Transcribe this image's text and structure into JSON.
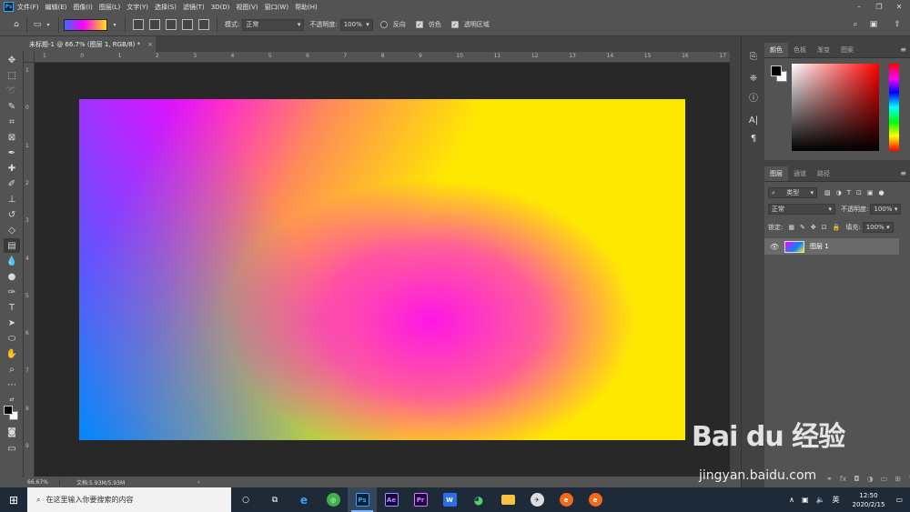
{
  "menu": {
    "logo": "Ps",
    "items": [
      "文件(F)",
      "编辑(E)",
      "图像(I)",
      "图层(L)",
      "文字(Y)",
      "选择(S)",
      "滤镜(T)",
      "3D(D)",
      "视图(V)",
      "窗口(W)",
      "帮助(H)"
    ]
  },
  "options": {
    "mode_label": "模式:",
    "mode_value": "正常",
    "opacity_label": "不透明度:",
    "opacity_value": "100%",
    "reverse_label": "反向",
    "dither_label": "仿色",
    "transparency_label": "透明区域"
  },
  "document": {
    "tab_title": "未标题-1 @ 66.7% (图层 1, RGB/8) *",
    "close": "×"
  },
  "ruler": {
    "top_ticks": [
      "1",
      "0",
      "1",
      "2",
      "3",
      "4",
      "5",
      "6",
      "7",
      "8",
      "9",
      "10",
      "11",
      "12",
      "13",
      "14",
      "15",
      "16",
      "17"
    ],
    "left_ticks": [
      "1",
      "0",
      "1",
      "2",
      "3",
      "4",
      "5",
      "6",
      "7",
      "8",
      "9"
    ]
  },
  "status": {
    "zoom": "66.67%",
    "doc_info": "文档:5.93M/5.93M",
    "arrow": "›"
  },
  "color_panel": {
    "tabs": [
      "颜色",
      "色板",
      "渐变",
      "图案"
    ]
  },
  "layers_panel": {
    "tabs": [
      "图层",
      "通道",
      "路径"
    ],
    "filter_value": "类型",
    "blend_value": "正常",
    "opacity_label": "不透明度:",
    "opacity_value": "100%",
    "lock_label": "锁定:",
    "fill_label": "填充:",
    "fill_value": "100%",
    "layer_name": "图层 1"
  },
  "taskbar": {
    "search_placeholder": "在这里输入你要搜索的内容",
    "apps": [
      "Ps",
      "Ae",
      "Pr",
      "W"
    ],
    "ime": "英",
    "time": "12:50",
    "date": "2020/2/15"
  },
  "watermark": {
    "logo": "Bai du 经验",
    "url": "jingyan.baidu.com"
  }
}
